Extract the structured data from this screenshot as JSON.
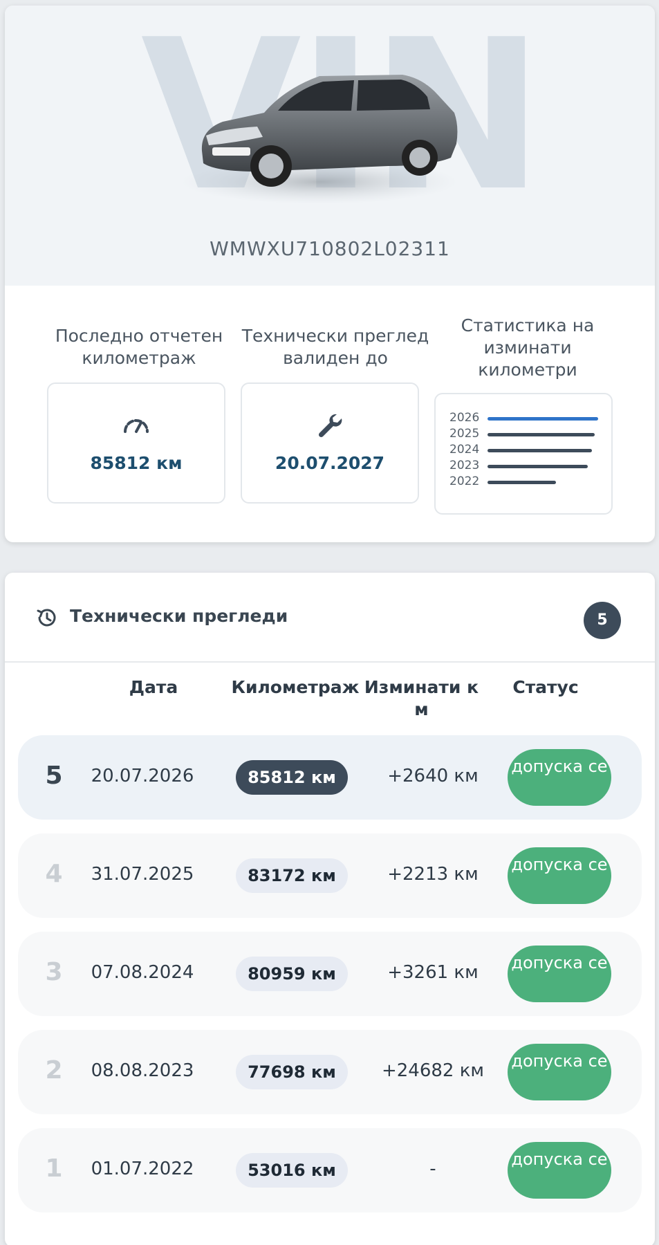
{
  "vehicle": {
    "watermark": "VIN",
    "vin": "WMWXU710802L02311"
  },
  "stats": {
    "last_km": {
      "label": "Последно отчетен километраж",
      "value": "85812 км",
      "icon": "speedometer-icon"
    },
    "inspection": {
      "label": "Технически преглед валиден до",
      "value": "20.07.2027",
      "icon": "wrench-icon"
    },
    "km_stats": {
      "label": "Статистика на изминати километри"
    }
  },
  "chart_data": {
    "type": "bar",
    "categories": [
      "2026",
      "2025",
      "2024",
      "2023",
      "2022"
    ],
    "values": [
      85812,
      83172,
      80959,
      77698,
      53016
    ],
    "xlim": [
      0,
      86000
    ],
    "highlight_color": "#2f74c9",
    "bar_color": "#3d4b5a"
  },
  "inspections": {
    "title": "Технически прегледи",
    "count": "5",
    "icon": "history-icon",
    "columns": [
      "Дата",
      "Километраж",
      "Изминати к м",
      "Статус"
    ],
    "rows": [
      {
        "num": "5",
        "date": "20.07.2026",
        "km": "85812 км",
        "diff": "+2640 км",
        "status": "допуска се"
      },
      {
        "num": "4",
        "date": "31.07.2025",
        "km": "83172 км",
        "diff": "+2213 км",
        "status": "допуска се"
      },
      {
        "num": "3",
        "date": "07.08.2024",
        "km": "80959 км",
        "diff": "+3261 км",
        "status": "допуска се"
      },
      {
        "num": "2",
        "date": "08.08.2023",
        "km": "77698 км",
        "diff": "+24682 км",
        "status": "допуска се"
      },
      {
        "num": "1",
        "date": "01.07.2022",
        "km": "53016 км",
        "diff": "-",
        "status": "допуска се"
      }
    ]
  },
  "colors": {
    "accent_dark": "#3d4b5a",
    "status_green": "#4cb07c",
    "value_blue": "#1d4e6e"
  }
}
